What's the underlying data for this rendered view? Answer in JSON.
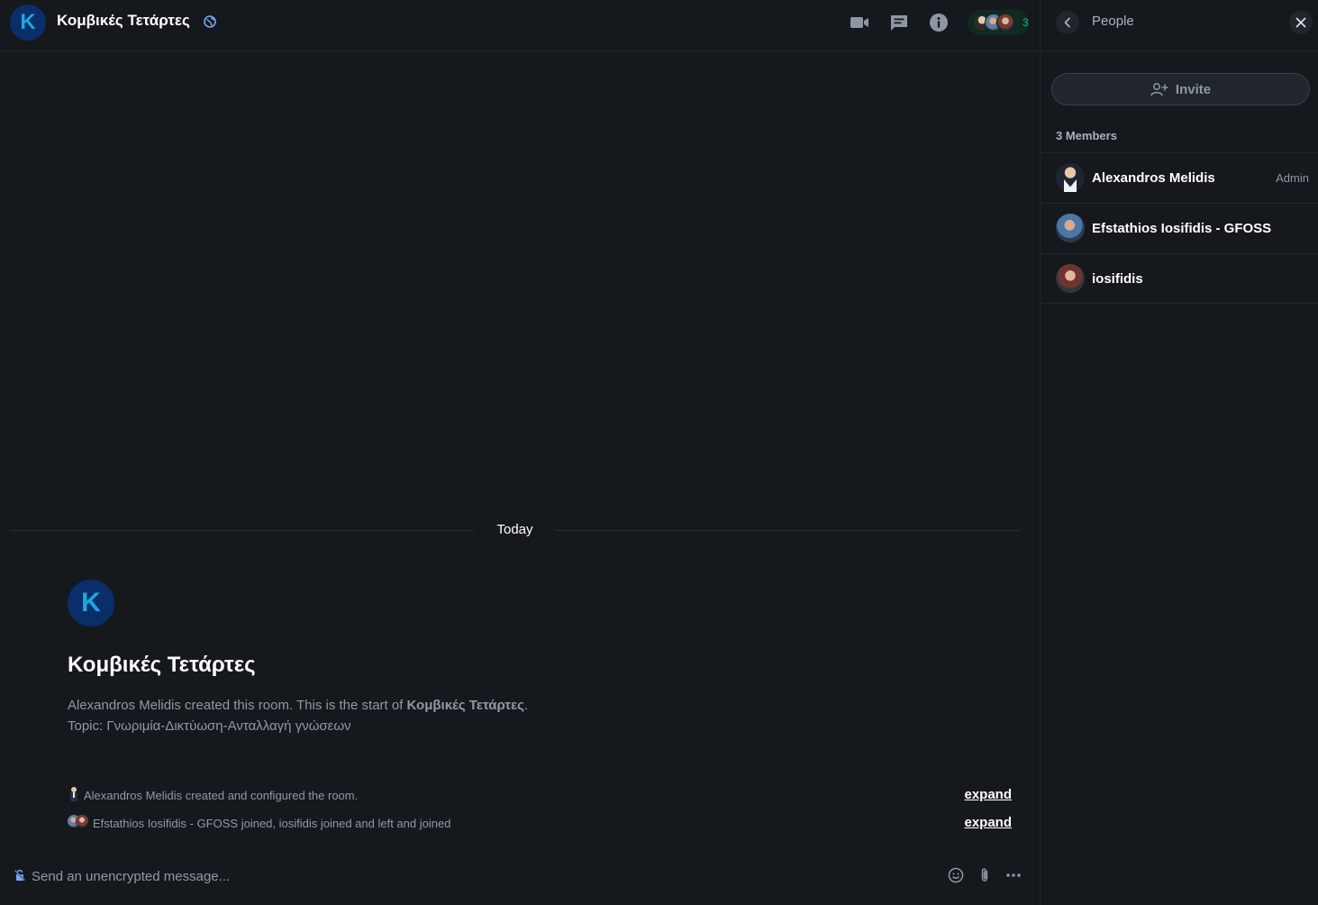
{
  "room": {
    "avatar_letter": "K",
    "name": "Κομβικές Τετάρτες",
    "member_count": "3"
  },
  "header": {
    "icons": [
      "video-call-icon",
      "threads-icon",
      "room-info-icon",
      "globe-icon"
    ]
  },
  "timeline": {
    "date_separator": "Today",
    "intro": {
      "avatar_letter": "K",
      "title": "Κομβικές Τετάρτες",
      "created_prefix": "Alexandros Melidis created this room. This is the start of ",
      "room_name_bold": "Κομβικές Τετάρτες",
      "created_suffix": ".",
      "topic": "Topic: Γνωριμία-Δικτύωση-Ανταλλαγή γνώσεων"
    },
    "events": [
      {
        "text": "Alexandros Melidis created and configured the room.",
        "action": "expand"
      },
      {
        "text": "Efstathios Iosifidis - GFOSS joined, iosifidis joined and left and joined",
        "action": "expand"
      }
    ]
  },
  "composer": {
    "placeholder": "Send an unencrypted message..."
  },
  "people_panel": {
    "title": "People",
    "invite_label": "Invite",
    "members_count_label": "3 Members",
    "members": [
      {
        "name": "Alexandros Melidis",
        "role": "Admin"
      },
      {
        "name": "Efstathios Iosifidis - GFOSS",
        "role": ""
      },
      {
        "name": "iosifidis",
        "role": ""
      }
    ]
  },
  "colors": {
    "background": "#15191e",
    "accent_green": "#0dbd8b",
    "avatar_bg": "#0a2e69",
    "avatar_letter": "#1ea6e4",
    "secondary_text": "#9199a4"
  }
}
